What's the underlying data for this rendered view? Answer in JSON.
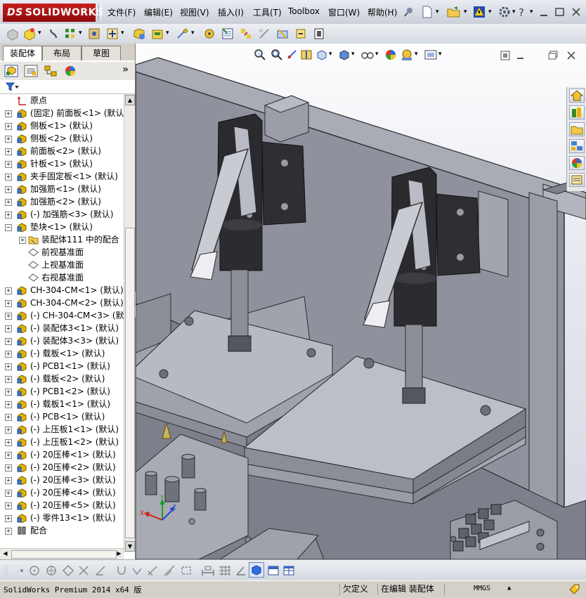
{
  "app": {
    "brand": "SOLIDWORKS",
    "brand_ds": "DS"
  },
  "menu": [
    "文件(F)",
    "编辑(E)",
    "视图(V)",
    "插入(I)",
    "工具(T)",
    "Toolbox",
    "窗口(W)",
    "帮助(H)"
  ],
  "panel": {
    "tabs": [
      "装配体",
      "布局",
      "草图"
    ],
    "expand_glyph": "»"
  },
  "tree": [
    {
      "label": "原点",
      "indent": 1,
      "icon": "origin-icon",
      "expand": false
    },
    {
      "label": "(固定) 前面板<1> (默认",
      "indent": 1,
      "icon": "part-icon",
      "expand": true
    },
    {
      "label": "侧板<1> (默认)",
      "indent": 1,
      "icon": "part-icon",
      "expand": true
    },
    {
      "label": "侧板<2> (默认)",
      "indent": 1,
      "icon": "part-icon",
      "expand": true
    },
    {
      "label": "前面板<2> (默认)",
      "indent": 1,
      "icon": "part-icon",
      "expand": true
    },
    {
      "label": "针板<1> (默认)",
      "indent": 1,
      "icon": "part-icon",
      "expand": true
    },
    {
      "label": "夹手固定板<1> (默认)",
      "indent": 1,
      "icon": "part-icon",
      "expand": true
    },
    {
      "label": "加强筋<1> (默认)",
      "indent": 1,
      "icon": "part-icon",
      "expand": true
    },
    {
      "label": "加强筋<2> (默认)",
      "indent": 1,
      "icon": "part-icon",
      "expand": true
    },
    {
      "label": "(-) 加强筋<3> (默认)",
      "indent": 1,
      "icon": "part-icon",
      "expand": true
    },
    {
      "label": "垫块<1> (默认)",
      "indent": 1,
      "icon": "part-icon",
      "expand": "minus"
    },
    {
      "label": "装配体111 中的配合",
      "indent": 2,
      "icon": "mate-folder-icon",
      "expand": true
    },
    {
      "label": "前视基准面",
      "indent": 2,
      "icon": "plane-icon",
      "expand": false
    },
    {
      "label": "上视基准面",
      "indent": 2,
      "icon": "plane-icon",
      "expand": false
    },
    {
      "label": "右视基准面",
      "indent": 2,
      "icon": "plane-icon",
      "expand": false
    },
    {
      "label": "CH-304-CM<1> (默认)",
      "indent": 1,
      "icon": "part-icon",
      "expand": true
    },
    {
      "label": "CH-304-CM<2> (默认)",
      "indent": 1,
      "icon": "part-icon",
      "expand": true
    },
    {
      "label": "(-) CH-304-CM<3> (默认",
      "indent": 1,
      "icon": "part-icon",
      "expand": true
    },
    {
      "label": "(-) 装配体3<1> (默认)",
      "indent": 1,
      "icon": "part-icon",
      "expand": true
    },
    {
      "label": "(-) 装配体3<3> (默认)",
      "indent": 1,
      "icon": "part-icon",
      "expand": true
    },
    {
      "label": "(-) 载板<1> (默认)",
      "indent": 1,
      "icon": "part-icon",
      "expand": true
    },
    {
      "label": "(-) PCB1<1> (默认)",
      "indent": 1,
      "icon": "part-icon",
      "expand": true
    },
    {
      "label": "(-) 载板<2> (默认)",
      "indent": 1,
      "icon": "part-icon",
      "expand": true
    },
    {
      "label": "(-) PCB1<2> (默认)",
      "indent": 1,
      "icon": "part-icon",
      "expand": true
    },
    {
      "label": "(-) 载板1<1> (默认)",
      "indent": 1,
      "icon": "part-icon",
      "expand": true
    },
    {
      "label": "(-) PCB<1> (默认)",
      "indent": 1,
      "icon": "part-icon",
      "expand": true
    },
    {
      "label": "(-) 上压板1<1> (默认)",
      "indent": 1,
      "icon": "part-icon",
      "expand": true
    },
    {
      "label": "(-) 上压板1<2> (默认)",
      "indent": 1,
      "icon": "part-icon",
      "expand": true
    },
    {
      "label": "(-) 20压棒<1> (默认)",
      "indent": 1,
      "icon": "part-icon",
      "expand": true
    },
    {
      "label": "(-) 20压棒<2> (默认)",
      "indent": 1,
      "icon": "part-icon",
      "expand": true
    },
    {
      "label": "(-) 20压棒<3> (默认)",
      "indent": 1,
      "icon": "part-icon",
      "expand": true
    },
    {
      "label": "(-) 20压棒<4> (默认)",
      "indent": 1,
      "icon": "part-icon",
      "expand": true
    },
    {
      "label": "(-) 20压棒<5> (默认)",
      "indent": 1,
      "icon": "part-icon",
      "expand": true
    },
    {
      "label": "(-) 零件13<1> (默认)",
      "indent": 1,
      "icon": "part-icon",
      "expand": true
    },
    {
      "label": "配合",
      "indent": 1,
      "icon": "mates-icon",
      "expand": true
    }
  ],
  "triad": {
    "x": "X",
    "y": "Y",
    "z": "Z"
  },
  "status": {
    "product": "SolidWorks Premium 2014 x64 版",
    "defined": "欠定义",
    "editing": "在编辑 装配体",
    "units": "MMGS",
    "units_arrow": "▲"
  },
  "colors": {
    "brand_red": "#b21818",
    "model_gray": "#8c8f9a",
    "model_dark": "#3a3a3e",
    "tree_part_yellow": "#e2b400"
  }
}
